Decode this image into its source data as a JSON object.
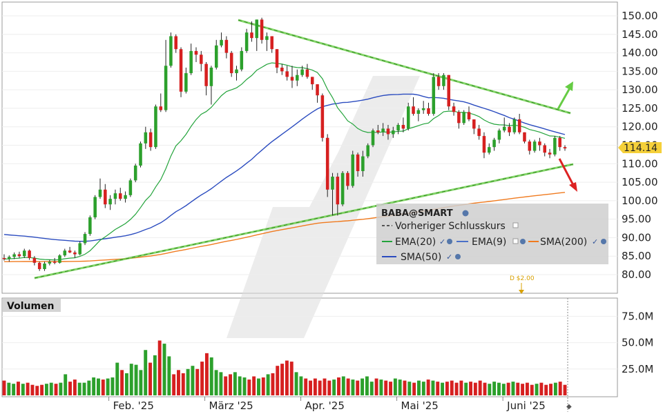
{
  "chart_data": {
    "type": "candlestick",
    "symbol_label": "BABA@SMART",
    "y_ticks": [
      "150.00",
      "145.00",
      "140.00",
      "135.00",
      "130.00",
      "125.00",
      "120.00",
      "115.00",
      "110.00",
      "105.00",
      "100.00",
      "95.00",
      "90.00",
      "85.00",
      "80.00"
    ],
    "ylim": [
      76,
      153
    ],
    "x_tick_labels": [
      {
        "label": "Feb. '25",
        "index": 24
      },
      {
        "label": "März '25",
        "index": 43
      },
      {
        "label": "Apr. '25",
        "index": 62
      },
      {
        "label": "Mai '25",
        "index": 81
      },
      {
        "label": "Juni '25",
        "index": 102
      }
    ],
    "last_price": "114.14",
    "legend": {
      "prev_close": "Vorheriger Schlusskurs",
      "ema20": "EMA(20)",
      "ema9": "EMA(9)",
      "sma200": "SMA(200)",
      "sma50": "SMA(50)"
    },
    "colors": {
      "up": "#2ca02c",
      "down": "#d62020",
      "ema20": "#22a33a",
      "ema9": "#4a6fc8",
      "sma200": "#f07a1e",
      "sma50": "#2a4bbf",
      "trendline": "#66cc44",
      "arrow_up": "#66cc44",
      "arrow_down": "#dd2222"
    },
    "volume_label": "Volumen",
    "volume_ticks": [
      "75.0M",
      "50.0M",
      "25.0M"
    ],
    "volume_ylim": [
      0,
      87
    ],
    "dividend_label": "D $2.00",
    "candles": [
      [
        84.5,
        85.5,
        83.8,
        84.2
      ],
      [
        84.2,
        85.2,
        83.5,
        84.8
      ],
      [
        84.8,
        86.0,
        84.2,
        85.5
      ],
      [
        85.5,
        86.2,
        84.5,
        85.0
      ],
      [
        85.0,
        87.0,
        84.5,
        86.5
      ],
      [
        86.5,
        86.8,
        84.0,
        84.5
      ],
      [
        84.5,
        85.0,
        82.5,
        83.2
      ],
      [
        83.2,
        83.5,
        81.0,
        81.5
      ],
      [
        81.5,
        83.5,
        81.0,
        83.0
      ],
      [
        83.0,
        84.0,
        82.5,
        83.5
      ],
      [
        83.5,
        84.5,
        82.8,
        83.2
      ],
      [
        83.2,
        85.5,
        83.0,
        85.2
      ],
      [
        85.2,
        87.0,
        84.8,
        86.5
      ],
      [
        86.5,
        87.5,
        85.8,
        86.0
      ],
      [
        86.0,
        86.5,
        84.5,
        85.5
      ],
      [
        85.5,
        89.0,
        85.2,
        88.5
      ],
      [
        88.5,
        91.5,
        88.0,
        91.0
      ],
      [
        91.0,
        96.0,
        90.5,
        95.5
      ],
      [
        95.5,
        101.5,
        95.0,
        101.0
      ],
      [
        101.0,
        106.0,
        100.5,
        103.0
      ],
      [
        103.0,
        104.5,
        98.0,
        99.0
      ],
      [
        99.0,
        101.5,
        97.5,
        100.5
      ],
      [
        100.5,
        103.0,
        99.0,
        102.0
      ],
      [
        102.0,
        103.5,
        100.0,
        100.5
      ],
      [
        100.5,
        102.5,
        99.5,
        101.5
      ],
      [
        101.5,
        106.0,
        101.0,
        105.5
      ],
      [
        105.5,
        110.0,
        105.0,
        109.5
      ],
      [
        109.5,
        116.0,
        109.0,
        115.5
      ],
      [
        115.5,
        120.0,
        114.0,
        118.5
      ],
      [
        118.5,
        119.5,
        113.5,
        114.5
      ],
      [
        114.5,
        126.0,
        114.0,
        125.5
      ],
      [
        125.5,
        129.0,
        124.0,
        124.5
      ],
      [
        124.5,
        143.5,
        124.0,
        136.5
      ],
      [
        136.5,
        145.5,
        136.0,
        144.5
      ],
      [
        144.5,
        145.0,
        140.0,
        141.0
      ],
      [
        141.0,
        141.5,
        128.0,
        129.5
      ],
      [
        129.5,
        136.0,
        129.0,
        134.5
      ],
      [
        134.5,
        142.5,
        134.0,
        140.5
      ],
      [
        140.5,
        141.5,
        137.5,
        139.5
      ],
      [
        139.5,
        140.5,
        135.0,
        137.0
      ],
      [
        137.0,
        137.5,
        128.5,
        131.0
      ],
      [
        131.0,
        136.5,
        126.0,
        136.0
      ],
      [
        136.0,
        143.5,
        135.5,
        142.0
      ],
      [
        142.0,
        145.5,
        141.5,
        143.5
      ],
      [
        143.5,
        144.5,
        138.5,
        140.0
      ],
      [
        140.0,
        140.5,
        133.5,
        134.5
      ],
      [
        134.5,
        136.5,
        132.5,
        135.5
      ],
      [
        135.5,
        141.5,
        135.0,
        140.5
      ],
      [
        140.5,
        146.5,
        140.0,
        145.5
      ],
      [
        145.5,
        148.5,
        143.0,
        144.0
      ],
      [
        144.0,
        149.0,
        140.5,
        149.0
      ],
      [
        149.0,
        149.5,
        142.5,
        143.5
      ],
      [
        143.5,
        145.5,
        140.5,
        144.5
      ],
      [
        144.5,
        144.0,
        140.0,
        141.0
      ],
      [
        141.0,
        140.0,
        134.5,
        136.0
      ],
      [
        136.0,
        137.0,
        134.0,
        135.0
      ],
      [
        135.0,
        136.5,
        132.5,
        133.5
      ],
      [
        133.5,
        136.5,
        130.5,
        132.5
      ],
      [
        132.5,
        135.5,
        131.0,
        134.0
      ],
      [
        134.0,
        136.5,
        133.5,
        135.5
      ],
      [
        135.5,
        137.0,
        133.0,
        133.5
      ],
      [
        133.5,
        133.0,
        130.0,
        131.5
      ],
      [
        131.5,
        131.0,
        126.5,
        128.5
      ],
      [
        128.5,
        129.0,
        116.0,
        117.0
      ],
      [
        117.0,
        118.0,
        101.0,
        103.0
      ],
      [
        103.0,
        107.5,
        96.0,
        106.5
      ],
      [
        106.5,
        107.5,
        96.0,
        99.0
      ],
      [
        99.0,
        108.0,
        98.5,
        107.5
      ],
      [
        107.5,
        108.0,
        103.0,
        104.0
      ],
      [
        104.0,
        113.5,
        103.5,
        112.5
      ],
      [
        112.5,
        113.0,
        106.5,
        108.0
      ],
      [
        108.0,
        113.5,
        106.5,
        112.0
      ],
      [
        112.0,
        115.5,
        111.5,
        115.0
      ],
      [
        115.0,
        119.5,
        114.5,
        119.0
      ],
      [
        119.0,
        120.5,
        118.0,
        118.5
      ],
      [
        118.5,
        121.0,
        117.5,
        119.5
      ],
      [
        119.5,
        120.5,
        116.5,
        118.0
      ],
      [
        118.0,
        120.0,
        117.0,
        119.0
      ],
      [
        119.0,
        121.0,
        118.0,
        120.5
      ],
      [
        120.5,
        122.5,
        118.5,
        119.5
      ],
      [
        119.5,
        126.5,
        119.0,
        125.5
      ],
      [
        125.5,
        128.0,
        123.0,
        123.5
      ],
      [
        123.5,
        125.0,
        121.5,
        124.5
      ],
      [
        124.5,
        127.0,
        123.5,
        125.0
      ],
      [
        125.0,
        126.5,
        123.0,
        123.5
      ],
      [
        123.5,
        134.5,
        123.0,
        133.5
      ],
      [
        133.5,
        134.5,
        130.0,
        131.0
      ],
      [
        131.0,
        134.5,
        130.0,
        134.0
      ],
      [
        134.0,
        127.5,
        124.5,
        125.5
      ],
      [
        125.5,
        126.5,
        123.0,
        124.0
      ],
      [
        124.0,
        124.5,
        119.5,
        121.0
      ],
      [
        121.0,
        124.5,
        120.5,
        124.0
      ],
      [
        124.0,
        125.5,
        121.5,
        122.0
      ],
      [
        122.0,
        121.5,
        118.0,
        119.5
      ],
      [
        119.5,
        120.5,
        116.5,
        117.5
      ],
      [
        117.5,
        118.5,
        111.5,
        113.0
      ],
      [
        113.0,
        115.5,
        112.5,
        114.5
      ],
      [
        114.5,
        117.0,
        113.5,
        116.5
      ],
      [
        116.5,
        119.5,
        115.5,
        119.0
      ],
      [
        119.0,
        122.5,
        118.5,
        120.0
      ],
      [
        120.0,
        121.0,
        117.5,
        118.5
      ],
      [
        118.5,
        122.5,
        118.0,
        122.0
      ],
      [
        122.0,
        123.5,
        118.0,
        118.5
      ],
      [
        118.5,
        118.0,
        115.5,
        116.0
      ],
      [
        116.0,
        116.5,
        112.5,
        113.5
      ],
      [
        113.5,
        116.5,
        113.0,
        116.0
      ],
      [
        116.0,
        117.0,
        113.5,
        115.0
      ],
      [
        115.0,
        115.5,
        112.0,
        113.0
      ],
      [
        113.0,
        114.0,
        111.5,
        112.5
      ],
      [
        112.5,
        117.5,
        112.0,
        117.0
      ],
      [
        117.0,
        117.5,
        113.5,
        114.5
      ],
      [
        114.5,
        115.0,
        113.5,
        114.14
      ]
    ],
    "volume": [
      14,
      12,
      11,
      13,
      11,
      12,
      10,
      9,
      10,
      11,
      12,
      11,
      12,
      20,
      13,
      15,
      12,
      12,
      14,
      17,
      16,
      15,
      16,
      17,
      31,
      24,
      21,
      30,
      29,
      24,
      43,
      31,
      38,
      52,
      49,
      37,
      20,
      24,
      21,
      25,
      28,
      25,
      32,
      40,
      36,
      24,
      22,
      18,
      20,
      22,
      18,
      17,
      15,
      18,
      16,
      17,
      20,
      21,
      28,
      30,
      33,
      32,
      22,
      18,
      16,
      14,
      16,
      14,
      16,
      14,
      15,
      17,
      18,
      16,
      15,
      14,
      16,
      18,
      13,
      16,
      15,
      14,
      13,
      16,
      15,
      14,
      13,
      12,
      14,
      13,
      15,
      14,
      13,
      12,
      13,
      14,
      12,
      14,
      12,
      13,
      12,
      14,
      12,
      11,
      13,
      12,
      11,
      12,
      13,
      12,
      11,
      12,
      10,
      11,
      12,
      10,
      11,
      12,
      13,
      10
    ]
  }
}
